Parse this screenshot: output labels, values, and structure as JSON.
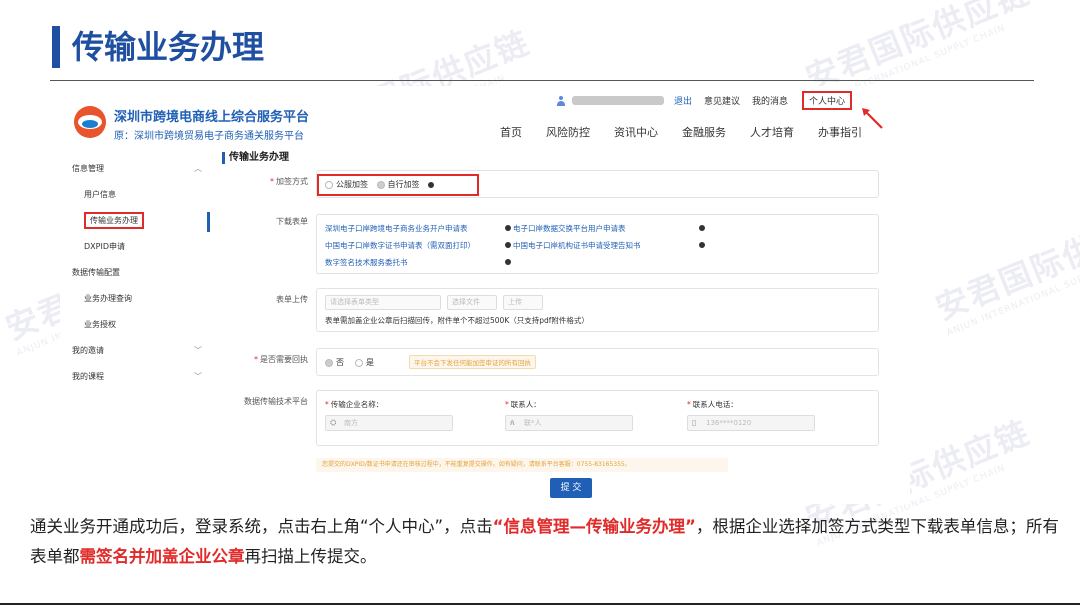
{
  "slide": {
    "title": "传输业务办理",
    "watermark": "安君国际供应链",
    "watermark_en": "ANJUN INTERNATIONAL SUPPLY CHAIN"
  },
  "header": {
    "site_name": "深圳市跨境电商线上综合服务平台",
    "site_old_name": "原：深圳市跨境贸易电子商务通关服务平台",
    "topbar": {
      "logout": "退出",
      "feedback": "意见建议",
      "messages": "我的消息",
      "user_center": "个人中心"
    },
    "nav": [
      "首页",
      "风险防控",
      "资讯中心",
      "金融服务",
      "人才培育",
      "办事指引"
    ]
  },
  "sidebar": {
    "groups": [
      {
        "label": "信息管理",
        "expanded": true
      },
      {
        "label": "我的邀请",
        "expanded": false
      },
      {
        "label": "我的课程",
        "expanded": false
      }
    ],
    "items": [
      "用户信息",
      "传输业务办理",
      "DXPID申请",
      "数据传输配置",
      "业务办理查询",
      "业务授权"
    ],
    "active_item": "传输业务办理"
  },
  "form": {
    "title": "传输业务办理",
    "sign_method": {
      "label": "加签方式",
      "options": [
        "公服加签",
        "自行加签"
      ],
      "selected": "自行加签"
    },
    "download": {
      "label": "下载表单",
      "links": [
        "深圳电子口岸跨境电子商务业务开户申请表",
        "电子口岸数据交换平台用户申请表",
        "中国电子口岸数字证书申请表（需双面打印）",
        "中国电子口岸机构证书申请受理告知书",
        "数字签名技术服务委托书"
      ]
    },
    "upload": {
      "label": "表单上传",
      "select_placeholder": "请选择表单类型",
      "choose_file": "选择文件",
      "upload_btn": "上传",
      "note": "表单需加盖企业公章后扫描回传，附件单个不超过500K（只支持pdf附件格式）"
    },
    "receipt": {
      "label": "是否需要回执",
      "options": [
        "否",
        "是"
      ],
      "selected": "否",
      "tip": "平台不会下发任何能加签审证的所有回执"
    },
    "platform": {
      "label": "数据传输技术平台",
      "company_label": "传输企业名称：",
      "company_value": "南方",
      "contact_label": "联系人：",
      "contact_value": "联*人",
      "phone_label": "联系人电话：",
      "phone_value": "136****0120"
    },
    "notice": "您提交的DXPID/数证书申请还在审核过程中，不能重复提交操作。如有疑问，请联系平台客服：0755-83165355。",
    "submit": "提 交"
  },
  "caption": {
    "p1": "通关业务开通成功后，登录系统，点击右上角“个人中心”，点击",
    "hl1": "“信息管理—传输业务办理”",
    "p2": "，根据企业选择加签方式类型下载表单信息；所有表单都",
    "hl2": "需签名并加盖企业公章",
    "p3": "再扫描上传提交。"
  },
  "colors": {
    "primary": "#1f4fa0",
    "highlight": "#e12a2a",
    "link": "#1f5fb5"
  }
}
